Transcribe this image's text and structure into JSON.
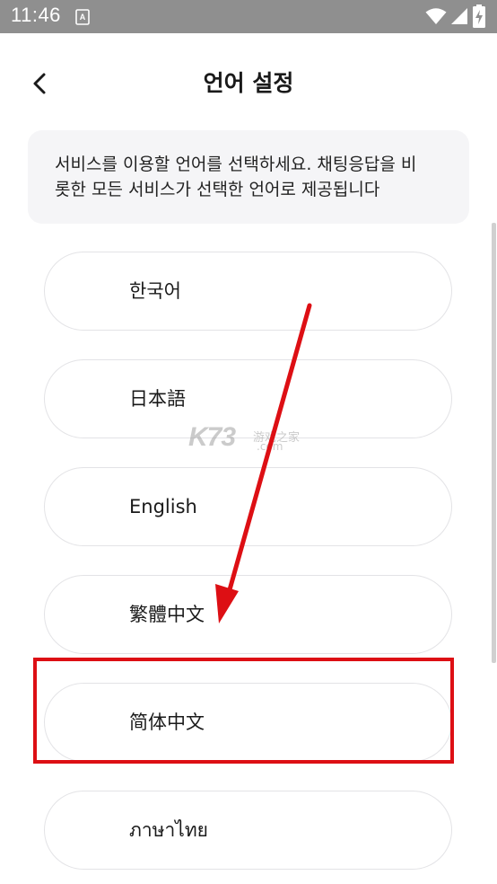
{
  "status_bar": {
    "time": "11:46",
    "background": "#8f8f8f",
    "icons": [
      "notification-a-icon",
      "wifi-icon",
      "signal-icon",
      "battery-charging-icon"
    ]
  },
  "header": {
    "title": "언어 설정",
    "back_icon": "chevron-left-icon"
  },
  "info": {
    "line1": "서비스를 이용할 언어를 선택하세요. 채팅응답을 비",
    "line2": "롯한 모든 서비스가 선택한 언어로 제공됩니다"
  },
  "languages": [
    {
      "label": "한국어"
    },
    {
      "label": "日本語"
    },
    {
      "label": "English"
    },
    {
      "label": "繁體中文"
    },
    {
      "label": "简体中文"
    },
    {
      "label": "ภาษาไทย"
    }
  ],
  "annotation": {
    "arrow_color": "#dd0f14",
    "highlight_color": "#dd0f14",
    "highlighted_item": "简体中文"
  },
  "watermark": {
    "main": "K73",
    "sub": "游戏之家",
    "domain": ".com"
  }
}
